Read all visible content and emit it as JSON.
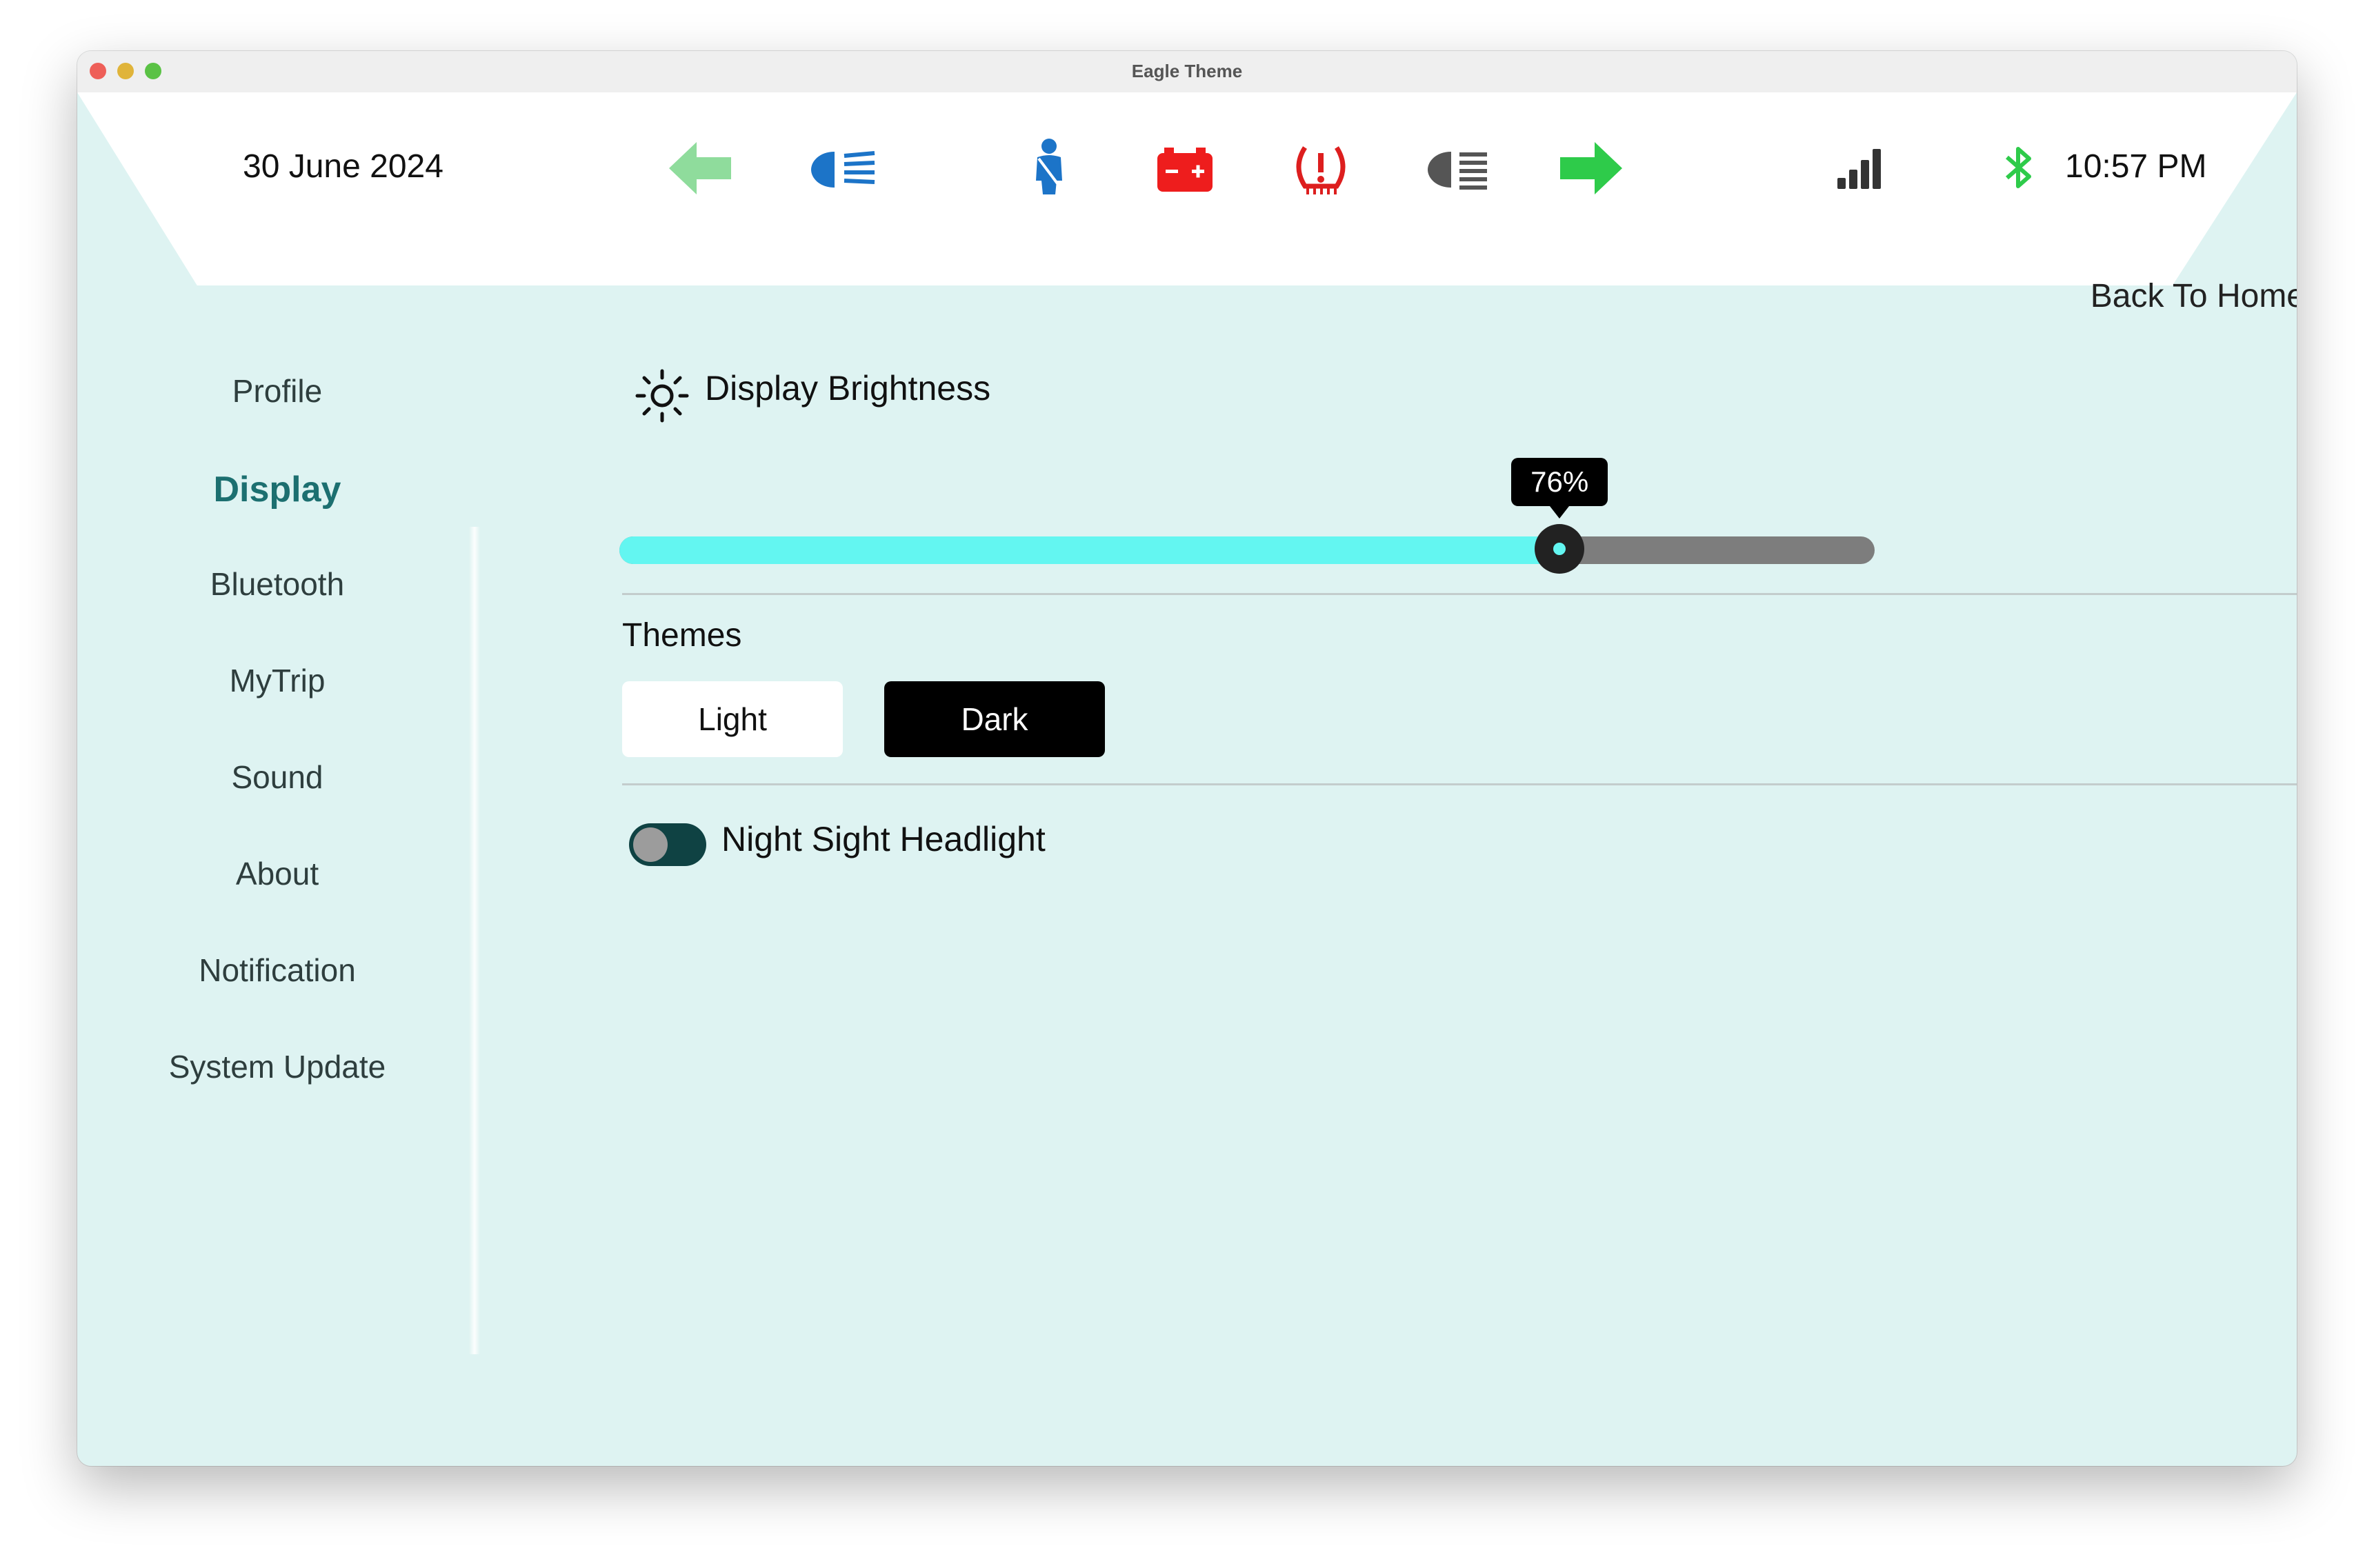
{
  "window": {
    "title": "Eagle Theme"
  },
  "status_bar": {
    "date": "30 June 2024",
    "time": "10:57 PM",
    "indicators": [
      {
        "icon": "left-turn-arrow-icon",
        "color": "#8fdc9c"
      },
      {
        "icon": "high-beam-headlight-icon",
        "color": "#1c74c8"
      },
      {
        "icon": "seatbelt-person-icon",
        "color": "#1c74c8"
      },
      {
        "icon": "battery-warning-icon",
        "color": "#ee1d1d"
      },
      {
        "icon": "tire-pressure-warning-icon",
        "color": "#dd1e1e"
      },
      {
        "icon": "low-beam-headlight-icon",
        "color": "#555555"
      },
      {
        "icon": "right-turn-arrow-icon",
        "color": "#2ecb4a"
      }
    ],
    "signal_icon": "cellular-signal-icon",
    "bluetooth_icon": "bluetooth-icon",
    "bluetooth_color": "#2ecb4a"
  },
  "back_to_home": "Back To Home",
  "sidebar": {
    "items": [
      {
        "label": "Profile",
        "active": false
      },
      {
        "label": "Display",
        "active": true
      },
      {
        "label": "Bluetooth",
        "active": false
      },
      {
        "label": "MyTrip",
        "active": false
      },
      {
        "label": "Sound",
        "active": false
      },
      {
        "label": "About",
        "active": false
      },
      {
        "label": "Notification",
        "active": false
      },
      {
        "label": "System Update",
        "active": false
      }
    ]
  },
  "display": {
    "brightness_label": "Display Brightness",
    "brightness_icon": "sun-brightness-icon",
    "brightness_percent": 76,
    "brightness_text": "76%",
    "themes_label": "Themes",
    "theme_light": "Light",
    "theme_dark": "Dark",
    "selected_theme": "Dark",
    "night_sight_label": "Night Sight Headlight",
    "night_sight_on": false
  },
  "colors": {
    "background": "#def3f2",
    "accent": "#1c6f70",
    "slider_fill": "#63f6f1",
    "slider_track": "#7d7d7d"
  }
}
